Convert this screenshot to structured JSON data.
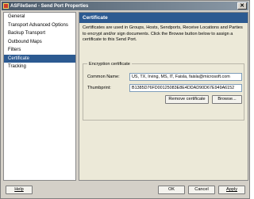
{
  "window": {
    "title": "ASFileSend - Send Port Properties",
    "close_glyph": "✕"
  },
  "sidebar": {
    "items": [
      {
        "label": "General",
        "selected": false
      },
      {
        "label": "Transport Advanced Options",
        "selected": false
      },
      {
        "label": "Backup Transport",
        "selected": false
      },
      {
        "label": "Outbound Maps",
        "selected": false
      },
      {
        "label": "Filters",
        "selected": false
      },
      {
        "label": "Certificate",
        "selected": true
      },
      {
        "label": "Tracking",
        "selected": false
      }
    ]
  },
  "panel": {
    "header": "Certificate",
    "description": "Certificates are used in Groups, Hosts, Sendports, Receive Locations and Parties to encrypt and/or sign documents. Click the Browse button below to assign a certificate to this Send Port.",
    "encryption": {
      "legend": "Encryption certificate",
      "common_name_label": "Common Name:",
      "common_name_value": "US, TX, Irving, MS, IT, Faisla, faisla@microsoft.com",
      "thumbprint_label": "Thumbprint:",
      "thumbprint_value": "B1385D76FD00125083E8E4DDAD90D67E949A6152",
      "remove_button": "Remove certificate",
      "browse_button": "Browse..."
    }
  },
  "footer": {
    "help_button": "Help",
    "ok_button": "OK",
    "cancel_button": "Cancel",
    "apply_button": "Apply"
  },
  "colors": {
    "selection": "#2c5a91",
    "header": "#2c5a91",
    "panel_body": "#ece9d8",
    "dialog": "#d4d0c8"
  },
  "icons": {
    "app": "biztalk-app-icon",
    "close": "close-icon"
  }
}
